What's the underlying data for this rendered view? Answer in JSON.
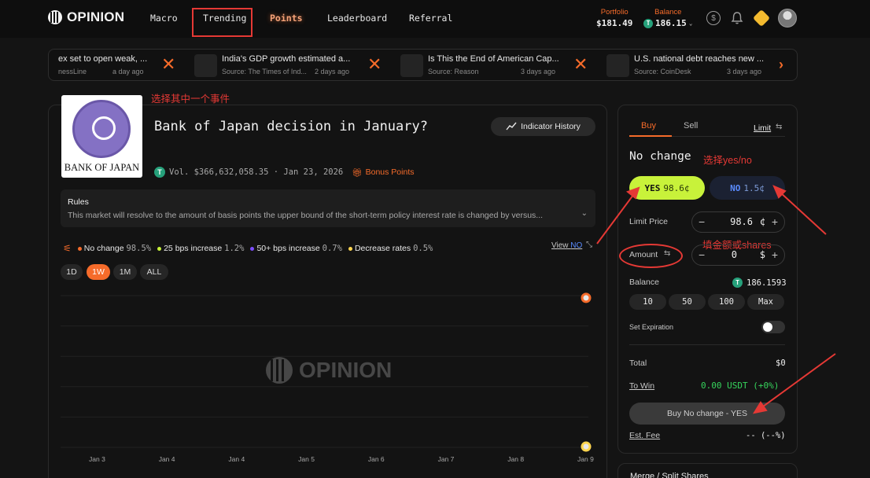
{
  "nav": {
    "brand": "OPINION",
    "items": [
      "Macro",
      "Trending",
      "Points",
      "Leaderboard",
      "Referral"
    ],
    "portfolio_label": "Portfolio",
    "portfolio_value": "$181.49",
    "balance_label": "Balance",
    "balance_value": "186.15"
  },
  "ticker": [
    {
      "title": "ex set to open weak, ...",
      "source": "nessLine",
      "time": "a day ago"
    },
    {
      "title": "India's GDP growth estimated a...",
      "source": "Source: The Times of Ind...",
      "time": "2 days ago"
    },
    {
      "title": "Is This the End of American Cap...",
      "source": "Source: Reason",
      "time": "3 days ago"
    },
    {
      "title": "U.S. national debt reaches new ...",
      "source": "Source: CoinDesk",
      "time": "3 days ago"
    }
  ],
  "annotations": {
    "select_event": "选择其中一个事件",
    "select_yes_no": "选择yes/no",
    "fill_amount": "填金额或shares"
  },
  "market": {
    "logo_text": "BANK OF JAPAN",
    "title": "Bank of Japan decision in January?",
    "indicator_history": "Indicator History",
    "volume": "Vol. $366,632,058.35 · Jan 23, 2026",
    "bonus": "Bonus Points",
    "rules_title": "Rules",
    "rules_text": "This market will resolve to the amount of basis points the upper bound of the short-term policy interest rate is changed by versus...",
    "legend": [
      {
        "label": "No change",
        "pct": "98.5%",
        "color": "#f56b2a"
      },
      {
        "label": "25 bps increase",
        "pct": "1.2%",
        "color": "#c8f23a"
      },
      {
        "label": "50+ bps increase",
        "pct": "0.7%",
        "color": "#7c4dff"
      },
      {
        "label": "Decrease rates",
        "pct": "0.5%",
        "color": "#ffd54f"
      }
    ],
    "view_prefix": "View",
    "view_no": "NO",
    "ranges": [
      "1D",
      "1W",
      "1M",
      "ALL"
    ],
    "active_range": "1W",
    "watermark": "OPINION"
  },
  "chart_data": {
    "type": "line",
    "x": [
      "Jan 3",
      "Jan 4",
      "Jan 4",
      "Jan 5",
      "Jan 6",
      "Jan 7",
      "Jan 8",
      "Jan 9"
    ],
    "series": [
      {
        "name": "No change",
        "color": "#f56b2a",
        "values": [
          98.5,
          98.5,
          98.5,
          98.5,
          98.5,
          98.5,
          98.5,
          98.5
        ]
      },
      {
        "name": "Decrease rates",
        "color": "#ffd54f",
        "values": [
          0.5,
          0.5,
          0.5,
          0.5,
          0.5,
          0.5,
          0.5,
          0.5
        ]
      }
    ],
    "ylim": [
      0,
      100
    ],
    "grid": true
  },
  "trade": {
    "tab_buy": "Buy",
    "tab_sell": "Sell",
    "order_type": "Limit",
    "outcome": "No change",
    "yes_label": "YES",
    "yes_price": "98.6¢",
    "no_label": "NO",
    "no_price": "1.5¢",
    "limit_price_label": "Limit Price",
    "limit_price_value": "98.6",
    "limit_price_unit": "¢",
    "amount_label": "Amount",
    "amount_value": "0",
    "amount_unit": "$",
    "balance_label": "Balance",
    "balance_value": "186.1593",
    "quick_amounts": [
      "10",
      "50",
      "100",
      "Max"
    ],
    "expiration_label": "Set Expiration",
    "total_label": "Total",
    "total_value": "$0",
    "to_win_label": "To Win",
    "to_win_value": "0.00 USDT (+0%)",
    "buy_button": "Buy No change - YES",
    "est_fee_label": "Est. Fee",
    "est_fee_value": "-- (--%)",
    "merge_label": "Merge / Split Shares"
  }
}
